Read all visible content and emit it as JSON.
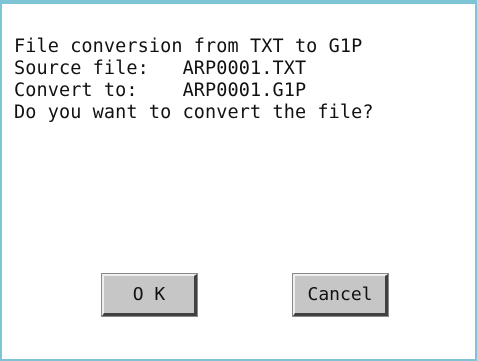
{
  "dialog": {
    "lines": [
      "File conversion from TXT to G1P",
      "Source file:   ARP0001.TXT",
      "Convert to:    ARP0001.G1P",
      "Do you want to convert the file?"
    ],
    "ok_label": "O K",
    "cancel_label": "Cancel"
  },
  "colors": {
    "frame": "#7fc4d6",
    "button_face": "#c6c6c6",
    "text": "#111111"
  }
}
